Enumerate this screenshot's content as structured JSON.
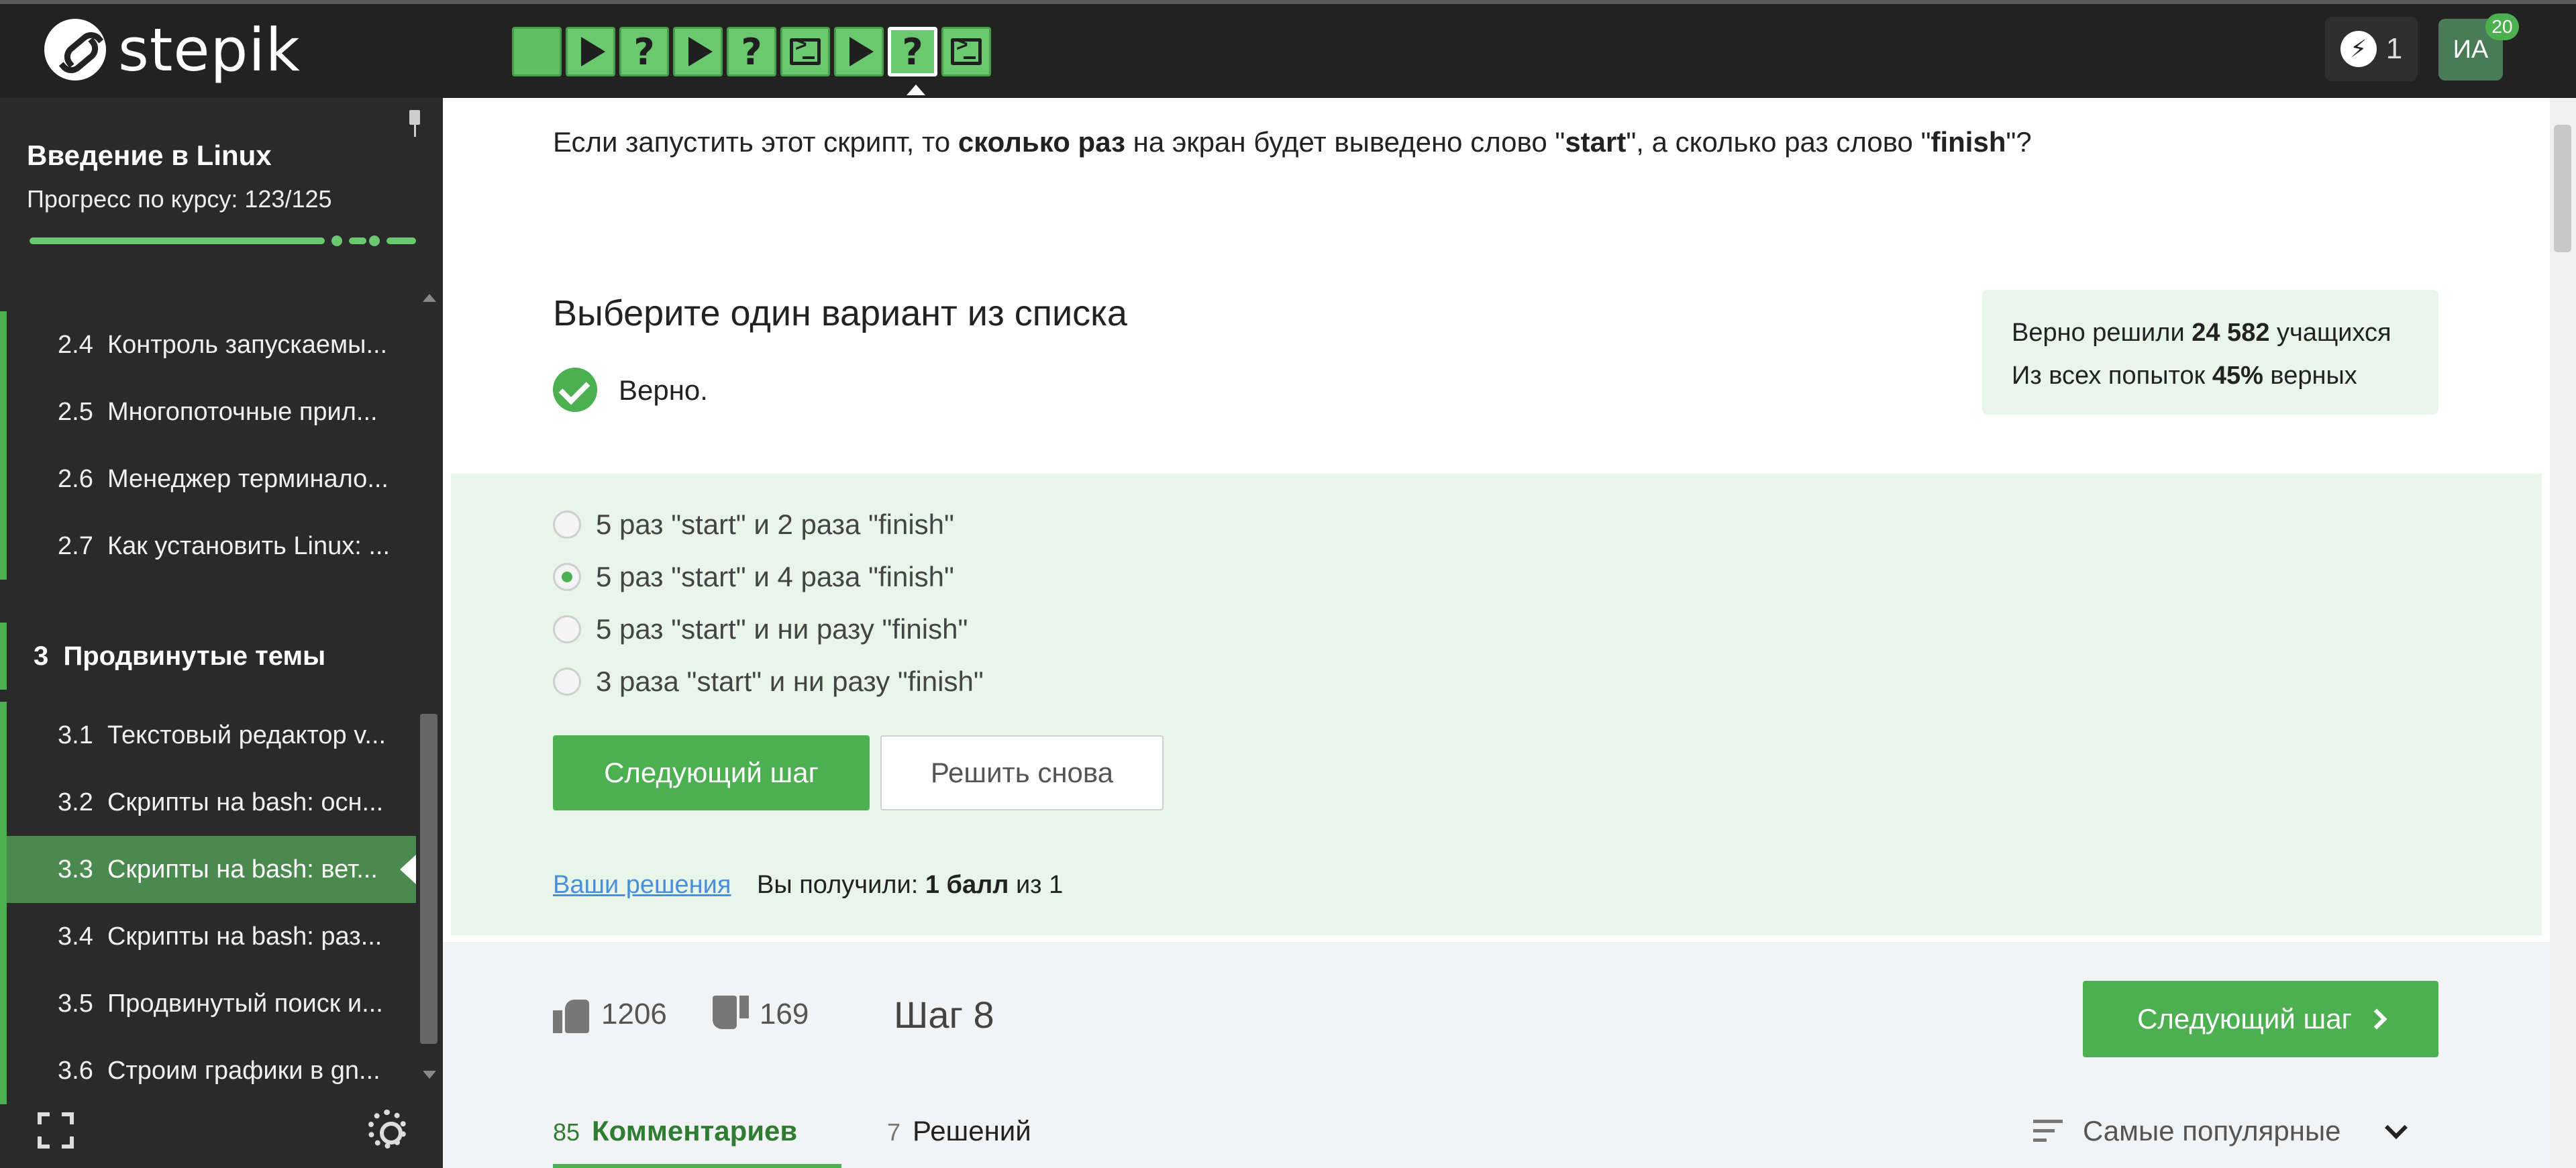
{
  "header": {
    "logo_text": "stepik",
    "steps": [
      {
        "kind": "plain",
        "icon": "blank-step-icon"
      },
      {
        "kind": "video",
        "icon": "play-icon"
      },
      {
        "kind": "quiz",
        "icon": "question-icon",
        "glyph": "?"
      },
      {
        "kind": "video",
        "icon": "play-icon"
      },
      {
        "kind": "quiz",
        "icon": "question-icon",
        "glyph": "?"
      },
      {
        "kind": "code",
        "icon": "terminal-icon"
      },
      {
        "kind": "video",
        "icon": "play-icon"
      },
      {
        "kind": "quiz",
        "icon": "question-icon",
        "glyph": "?",
        "active": true
      },
      {
        "kind": "code",
        "icon": "terminal-icon"
      }
    ],
    "energy_count": "1",
    "avatar_initials": "ИА",
    "avatar_badge": "20"
  },
  "sidebar": {
    "course_title": "Введение в Linux",
    "progress_text": "Прогресс по курсу:  123/125",
    "progress_fraction": 0.984,
    "lessons_before": [
      {
        "num": "2.4",
        "title": "Контроль запускаемы..."
      },
      {
        "num": "2.5",
        "title": "Многопоточные прил..."
      },
      {
        "num": "2.6",
        "title": "Менеджер терминало..."
      },
      {
        "num": "2.7",
        "title": "Как установить Linux: ..."
      }
    ],
    "section": {
      "num": "3",
      "title": "Продвинутые темы"
    },
    "lessons_after": [
      {
        "num": "3.1",
        "title": "Текстовый редактор v..."
      },
      {
        "num": "3.2",
        "title": "Скрипты на bash: осн..."
      },
      {
        "num": "3.3",
        "title": "Скрипты на bash: вет...",
        "active": true
      },
      {
        "num": "3.4",
        "title": "Скрипты на bash: раз..."
      },
      {
        "num": "3.5",
        "title": "Продвинутый поиск и..."
      },
      {
        "num": "3.6",
        "title": "Строим графики в gn..."
      }
    ]
  },
  "main": {
    "question_parts": [
      {
        "text": "Если запустить этот скрипт, то ",
        "bold": false
      },
      {
        "text": "сколько раз",
        "bold": true
      },
      {
        "text": " на экран будет выведено слово \"",
        "bold": false
      },
      {
        "text": "start",
        "bold": true
      },
      {
        "text": "\", а сколько раз слово \"",
        "bold": false
      },
      {
        "text": "finish",
        "bold": true
      },
      {
        "text": "\"?",
        "bold": false
      }
    ],
    "choose_title": "Выберите один вариант из списка",
    "verdict": "Верно.",
    "stats": {
      "solved_prefix": "Верно решили ",
      "solved_count": "24 582",
      "solved_suffix": " учащихся",
      "attempts_prefix": "Из всех попыток ",
      "attempts_percent": "45%",
      "attempts_suffix": " верных"
    },
    "options": [
      {
        "label": "5 раз \"start\" и 2 раза \"finish\"",
        "checked": false
      },
      {
        "label": "5 раз \"start\" и 4 раза \"finish\"",
        "checked": true
      },
      {
        "label": "5 раз \"start\" и ни разу \"finish\"",
        "checked": false
      },
      {
        "label": "3 раза \"start\" и ни разу \"finish\"",
        "checked": false
      }
    ],
    "next_button": "Следующий шаг",
    "retry_button": "Решить снова",
    "solutions_link": "Ваши решения",
    "score_prefix": "Вы получили: ",
    "score_value": "1 балл",
    "score_suffix": " из 1"
  },
  "footer": {
    "likes": "1206",
    "dislikes": "169",
    "step_label": "Шаг 8",
    "next_button": "Следующий шаг",
    "comments_count": "85",
    "comments_label": "Комментариев",
    "solutions_count": "7",
    "solutions_label": "Решений",
    "sort_label": "Самые популярные"
  }
}
